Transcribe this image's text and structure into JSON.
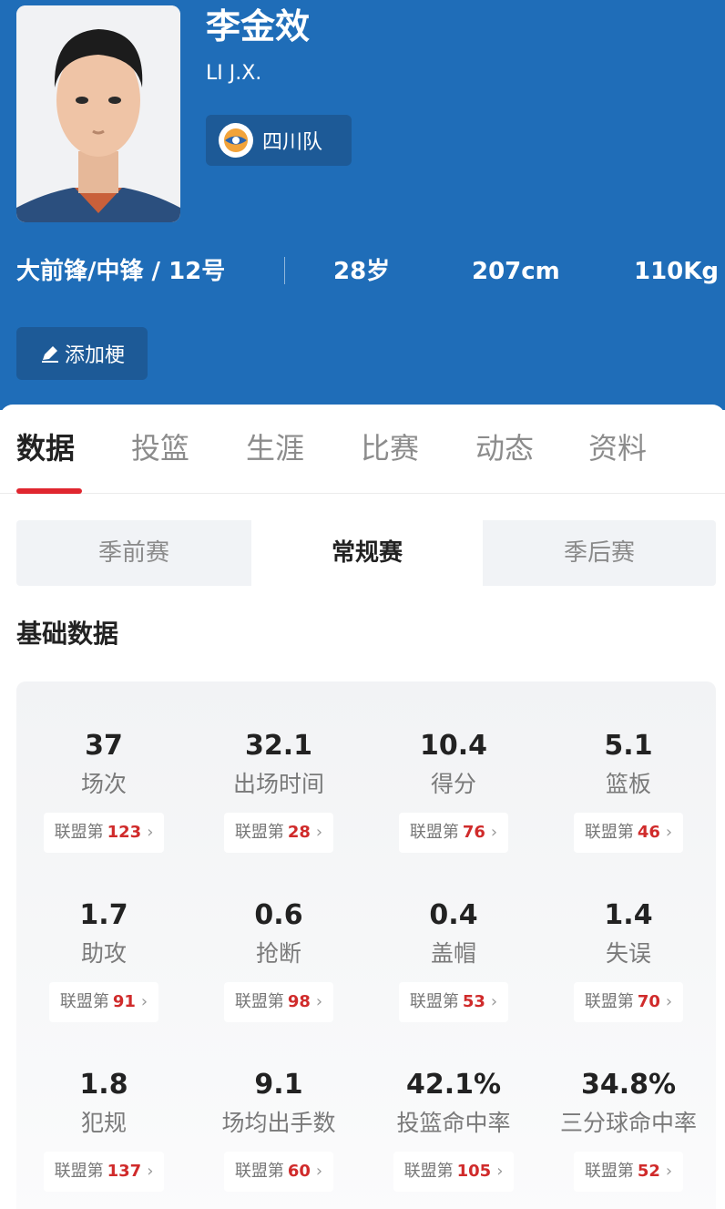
{
  "player": {
    "name": "李金效",
    "english_name": "LI J.X.",
    "team": "四川队",
    "position_number": "大前锋/中锋 / 12号",
    "age": "28岁",
    "height": "207cm",
    "weight": "110Kg",
    "add_tag_label": "添加梗"
  },
  "tabs": [
    "数据",
    "投篮",
    "生涯",
    "比赛",
    "动态",
    "资料"
  ],
  "season_tabs": [
    "季前赛",
    "常规赛",
    "季后赛"
  ],
  "section_title": "基础数据",
  "rank_prefix": "联盟第",
  "stats": [
    {
      "value": "37",
      "label": "场次",
      "rank": "123"
    },
    {
      "value": "32.1",
      "label": "出场时间",
      "rank": "28"
    },
    {
      "value": "10.4",
      "label": "得分",
      "rank": "76"
    },
    {
      "value": "5.1",
      "label": "篮板",
      "rank": "46"
    },
    {
      "value": "1.7",
      "label": "助攻",
      "rank": "91"
    },
    {
      "value": "0.6",
      "label": "抢断",
      "rank": "98"
    },
    {
      "value": "0.4",
      "label": "盖帽",
      "rank": "53"
    },
    {
      "value": "1.4",
      "label": "失误",
      "rank": "70"
    },
    {
      "value": "1.8",
      "label": "犯规",
      "rank": "137"
    },
    {
      "value": "9.1",
      "label": "场均出手数",
      "rank": "60"
    },
    {
      "value": "42.1%",
      "label": "投篮命中率",
      "rank": "105"
    },
    {
      "value": "34.8%",
      "label": "三分球命中率",
      "rank": "52"
    }
  ]
}
